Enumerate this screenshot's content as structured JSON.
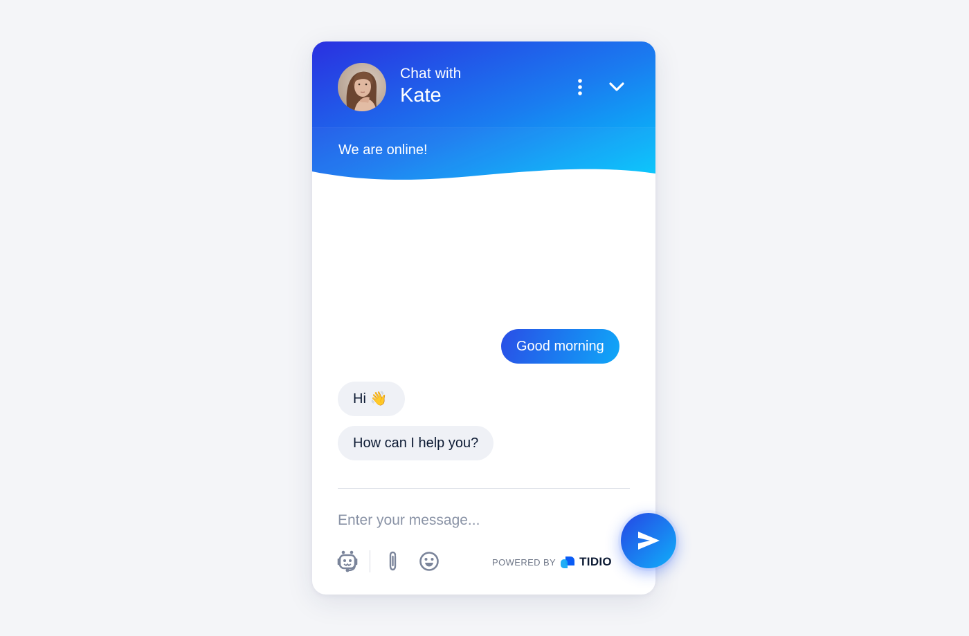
{
  "header": {
    "subtitle": "Chat with",
    "agent_name": "Kate",
    "status": "We are online!",
    "avatar": "agent-avatar-photo",
    "menu_icon": "more-vertical-icon",
    "collapse_icon": "chevron-down-icon"
  },
  "colors": {
    "gradient_start": "#2a2fe0",
    "gradient_mid": "#1a7cf0",
    "gradient_end": "#04c8fc",
    "bubble_in": "#eff1f6",
    "text_dark": "#0c1a33",
    "icon_gray": "#7a849a"
  },
  "messages": [
    {
      "direction": "outgoing",
      "text": "Good morning"
    },
    {
      "direction": "incoming",
      "text": "Hi 👋"
    },
    {
      "direction": "incoming",
      "text": "How can I help you?"
    }
  ],
  "composer": {
    "placeholder": "Enter your message...",
    "value": "",
    "icons": [
      "bot-icon",
      "paperclip-icon",
      "emoji-icon"
    ],
    "send_icon": "send-icon"
  },
  "footer": {
    "powered_by": "POWERED BY",
    "brand": "TIDIO"
  }
}
